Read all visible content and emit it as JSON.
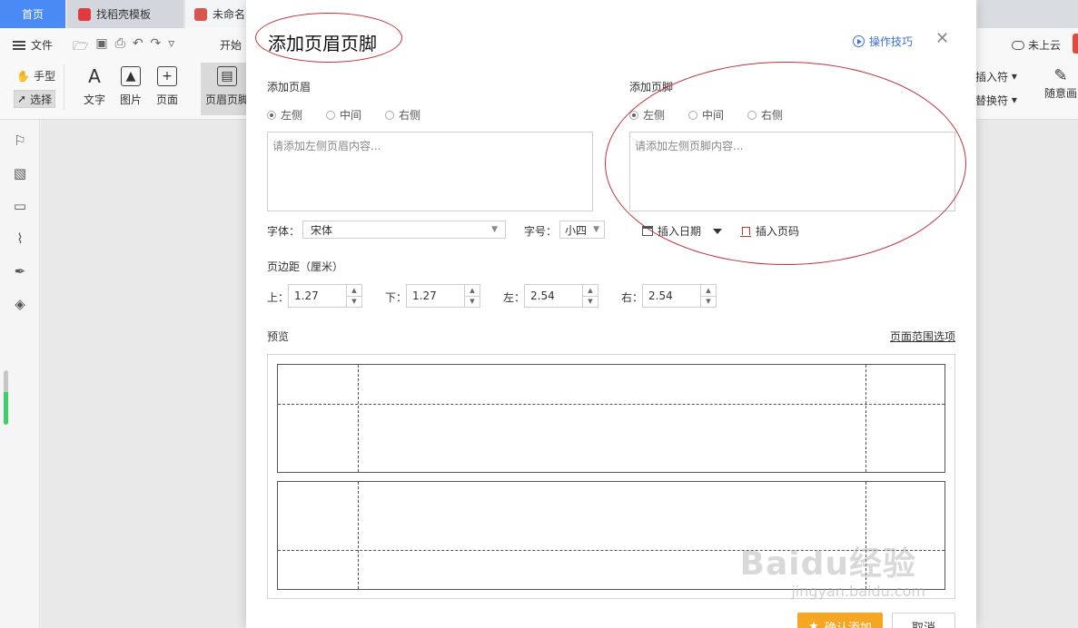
{
  "tabs": {
    "home": "首页",
    "template": "找稻壳模板",
    "doc": "未命名"
  },
  "toolbar": {
    "file_menu": "文件",
    "start_menu": "开始",
    "hand_tool": "手型",
    "select_tool": "选择",
    "text_tool": "文字",
    "image_tool": "图片",
    "page_tool": "页面",
    "header_footer_tool": "页眉页脚",
    "insert_symbol": "插入符",
    "replace_symbol": "替换符",
    "freehand": "随意画",
    "cloud_status": "未上云"
  },
  "dialog": {
    "title": "添加页眉页脚",
    "tips_link": "操作技巧",
    "header_section": "添加页眉",
    "footer_section": "添加页脚",
    "align_options": [
      "左侧",
      "中间",
      "右侧"
    ],
    "header_placeholder": "请添加左侧页眉内容...",
    "footer_placeholder": "请添加左侧页脚内容...",
    "font_label": "字体：",
    "font_value": "宋体",
    "size_label": "字号：",
    "size_value": "小四",
    "insert_date": "插入日期",
    "insert_page_number": "插入页码",
    "margins_label": "页边距（厘米）",
    "margin_top_label": "上：",
    "margin_top": "1.27",
    "margin_bottom_label": "下：",
    "margin_bottom": "1.27",
    "margin_left_label": "左：",
    "margin_left": "2.54",
    "margin_right_label": "右：",
    "margin_right": "2.54",
    "preview_label": "预览",
    "page_range_link": "页面范围选项",
    "confirm_button": "确认添加",
    "cancel_button": "取消"
  },
  "watermark": {
    "brand": "Baidu经验",
    "url": "jingyan.baidu.com"
  },
  "colors": {
    "accent_blue": "#4a8af4",
    "confirm_orange": "#f5a623",
    "annotation_red": "#c0313b",
    "link_blue": "#3d6fd9"
  }
}
